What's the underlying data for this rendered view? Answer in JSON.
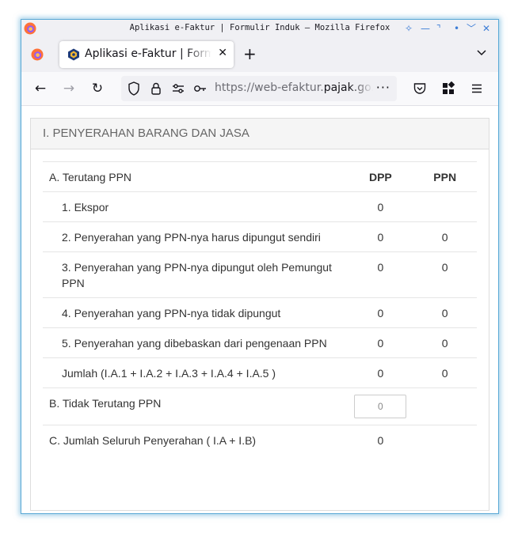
{
  "window": {
    "title": "Aplikasi e-Faktur | Formulir Induk — Mozilla Firefox",
    "controls": [
      "✧",
      "—",
      "⌝",
      "•",
      "﹀",
      "✕"
    ]
  },
  "tabs": [
    {
      "label": "Aplikasi e-Faktur | Formulir Induk",
      "close": "✕"
    }
  ],
  "new_tab_label": "+",
  "tab_list_label": "⌄",
  "nav": {
    "back": "←",
    "forward": "→",
    "reload": "↻",
    "url_prefix": "https://web-efaktur.",
    "url_domain": "pajak.go.id",
    "url_more": "···",
    "pocket": "⛉",
    "extensions": "▦",
    "menu": "≡"
  },
  "section": {
    "title": "I. PENYERAHAN BARANG DAN JASA",
    "header": {
      "label": "A. Terutang PPN",
      "dpp": "DPP",
      "ppn": "PPN"
    },
    "rows": [
      {
        "label": "1. Ekspor",
        "dpp": "0",
        "ppn": ""
      },
      {
        "label": "2. Penyerahan yang PPN-nya harus dipungut sendiri",
        "dpp": "0",
        "ppn": "0"
      },
      {
        "label": "3. Penyerahan yang PPN-nya dipungut oleh Pemungut PPN",
        "dpp": "0",
        "ppn": "0"
      },
      {
        "label": "4. Penyerahan yang PPN-nya tidak dipungut",
        "dpp": "0",
        "ppn": "0"
      },
      {
        "label": "5. Penyerahan yang dibebaskan dari pengenaan PPN",
        "dpp": "0",
        "ppn": "0"
      },
      {
        "label": "Jumlah (I.A.1 + I.A.2 + I.A.3 + I.A.4 + I.A.5 )",
        "dpp": "0",
        "ppn": "0"
      }
    ],
    "b_row": {
      "label": "B. Tidak Terutang PPN",
      "input_value": "0"
    },
    "c_row": {
      "label": "C. Jumlah Seluruh Penyerahan ( I.A + I.B)",
      "dpp": "0"
    }
  },
  "colors": {
    "window_border": "#5aa9d6",
    "firefox_orange": "#ff7139",
    "firefox_purple": "#9059ff"
  }
}
